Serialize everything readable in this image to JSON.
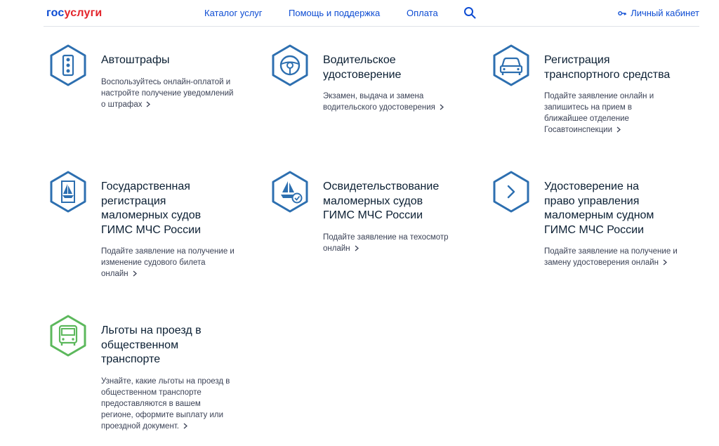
{
  "header": {
    "logo_part1": "гос",
    "logo_part2": "услуги",
    "nav": [
      "Каталог услуг",
      "Помощь и поддержка",
      "Оплата"
    ],
    "cabinet_label": "Личный кабинет"
  },
  "colors": {
    "brand_blue": "#0d4cd3",
    "brand_red": "#e3242b",
    "icon_blue": "#2d6fb0",
    "icon_green": "#5cb85c"
  },
  "cards": [
    {
      "title": "Автоштрафы",
      "description": "Воспользуйтесь онлайн-оплатой и\nнастройте получение уведомлений\nо штрафах",
      "icon": "traffic-light-icon"
    },
    {
      "title": "Водительское\nудостоверение",
      "description": "Экзамен, выдача и замена\nводительского удостоверения",
      "icon": "steering-wheel-icon"
    },
    {
      "title": "Регистрация\nтранспортного средства",
      "description": "Подайте заявление онлайн и\nзапишитесь на прием в\nближайшее отделение\nГосавтоинспекции",
      "icon": "car-icon"
    },
    {
      "title": "Государственная\nрегистрация\nмаломерных судов\nГИМС МЧС России",
      "description": "Подайте заявление на получение и\nизменение судового билета\nонлайн",
      "icon": "boat-document-icon"
    },
    {
      "title": "Освидетельствование\nмаломерных судов\nГИМС МЧС России",
      "description": "Подайте заявление на техосмотр\nонлайн",
      "icon": "boat-check-icon"
    },
    {
      "title": "Удостоверение на\nправо управления\nмаломерным судном\nГИМС МЧС России",
      "description": "Подайте заявление на получение и\nзамену удостоверения онлайн",
      "icon": "chevron-right-icon"
    },
    {
      "title": "Льготы на проезд в\nобщественном\nтранспорте",
      "description": "Узнайте, какие льготы на проезд в\nобщественном транспорте\nпредоставляются в вашем\nрегионе, оформите выплату или\nпроездной документ.",
      "icon": "bus-icon"
    }
  ]
}
